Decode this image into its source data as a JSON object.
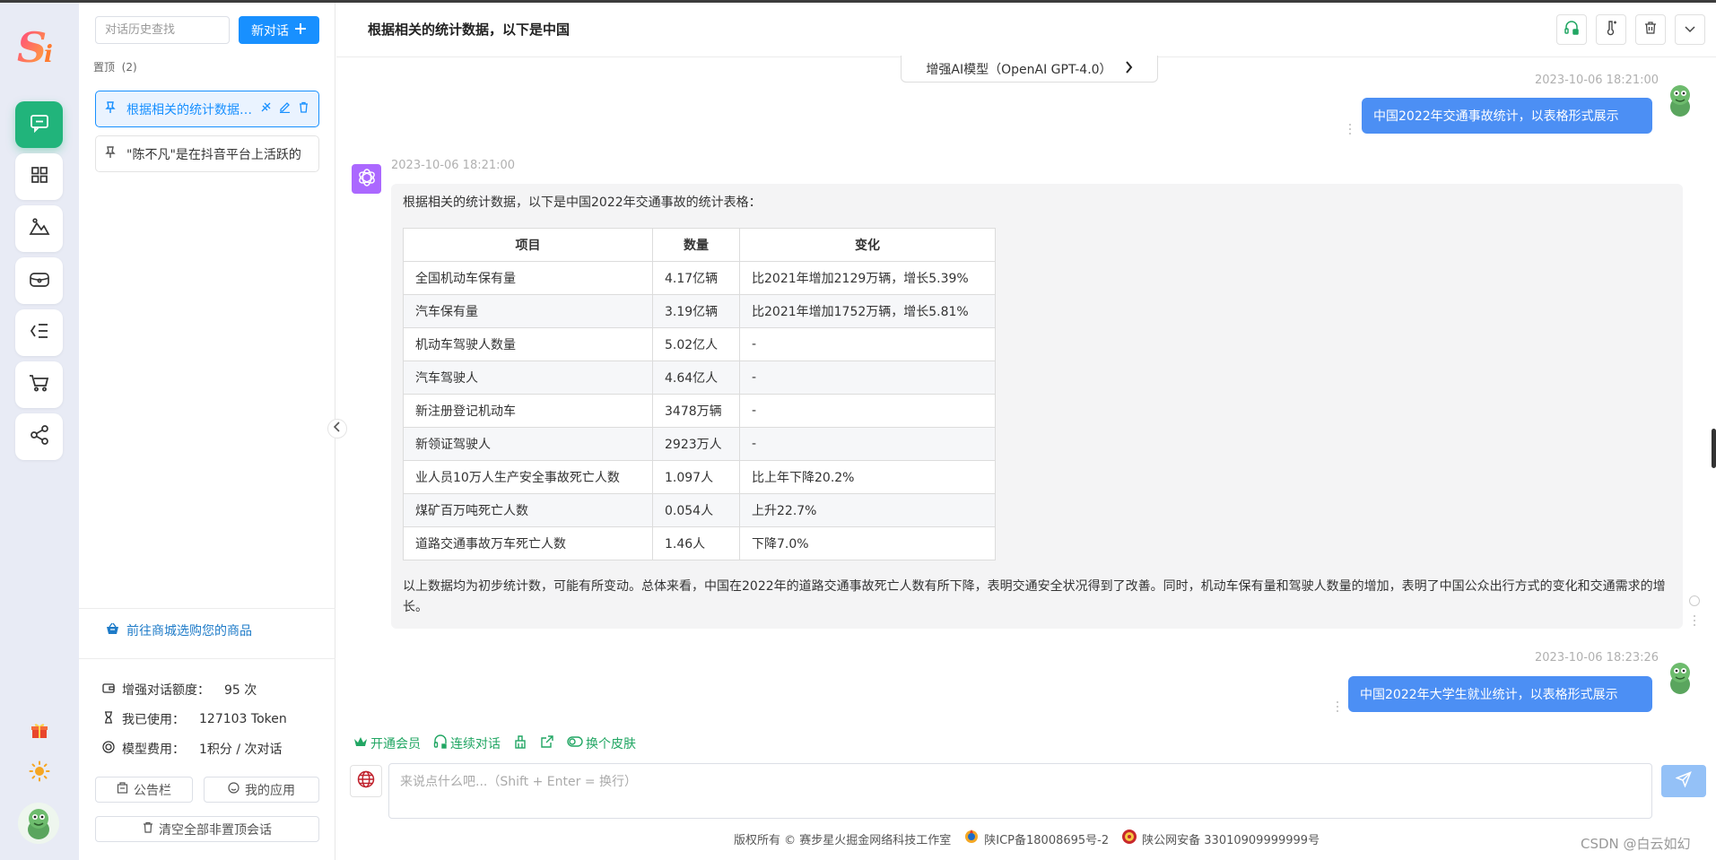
{
  "sidebar_rail": {
    "logo_text": "Si",
    "items": [
      {
        "name": "chat"
      },
      {
        "name": "apps"
      },
      {
        "name": "image"
      },
      {
        "name": "wallet"
      },
      {
        "name": "menu"
      },
      {
        "name": "cart"
      },
      {
        "name": "share"
      }
    ]
  },
  "history": {
    "search_placeholder": "对话历史查找",
    "new_chat_label": "新对话",
    "pinned_label": "置顶",
    "pinned_count": "(2)",
    "conversations": [
      {
        "title": "根据相关的统计数据，以下是中国"
      },
      {
        "title": "\"陈不凡\"是在抖音平台上活跃的"
      }
    ],
    "shop_link": "前往商城选购您的商品",
    "stats": {
      "quota_label": "增强对话额度：",
      "quota_value": "95 次",
      "used_label": "我已使用：",
      "used_value": "127103 Token",
      "fee_label": "模型费用：",
      "fee_value": "1积分 / 次对话"
    },
    "notice_button": "公告栏",
    "apps_button": "我的应用",
    "clear_button": "清空全部非置顶会话"
  },
  "header": {
    "title": "根据相关的统计数据，以下是中国"
  },
  "model_selector": {
    "label": "增强AI模型（OpenAI GPT-4.0）"
  },
  "messages": {
    "user1": {
      "time": "2023-10-06 18:21:00",
      "text": "中国2022年交通事故统计，以表格形式展示"
    },
    "assistant": {
      "time": "2023-10-06 18:21:00",
      "intro": "根据相关的统计数据，以下是中国2022年交通事故的统计表格：",
      "table": {
        "headers": [
          "项目",
          "数量",
          "变化"
        ],
        "rows": [
          [
            "全国机动车保有量",
            "4.17亿辆",
            "比2021年增加2129万辆，增长5.39%"
          ],
          [
            "汽车保有量",
            "3.19亿辆",
            "比2021年增加1752万辆，增长5.81%"
          ],
          [
            "机动车驾驶人数量",
            "5.02亿人",
            "-"
          ],
          [
            "汽车驾驶人",
            "4.64亿人",
            "-"
          ],
          [
            "新注册登记机动车",
            "3478万辆",
            "-"
          ],
          [
            "新领证驾驶人",
            "2923万人",
            "-"
          ],
          [
            "业人员10万人生产安全事故死亡人数",
            "1.097人",
            "比上年下降20.2%"
          ],
          [
            "煤矿百万吨死亡人数",
            "0.054人",
            "上升22.7%"
          ],
          [
            "道路交通事故万车死亡人数",
            "1.46人",
            "下降7.0%"
          ]
        ]
      },
      "summary": "以上数据均为初步统计数，可能有所变动。总体来看，中国在2022年的道路交通事故死亡人数有所下降，表明交通安全状况得到了改善。同时，机动车保有量和驾驶人数量的增加，表明了中国公众出行方式的变化和交通需求的增长。"
    },
    "user2": {
      "time": "2023-10-06 18:23:26",
      "text": "中国2022年大学生就业统计，以表格形式展示"
    }
  },
  "toolbar": {
    "vip_label": "开通会员",
    "continuous_label": "连续对话",
    "skin_label": "换个皮肤"
  },
  "input": {
    "placeholder": "来说点什么吧...（Shift + Enter = 换行）"
  },
  "footer": {
    "copyright": "版权所有 © 赛步星火掘金网络科技工作室",
    "icp": "陕ICP备18008695号-2",
    "police": "陕公网安备 33010909999999号"
  },
  "watermark": "CSDN @白云如幻",
  "colors": {
    "accent_green": "#21b47b",
    "primary_blue": "#1890ff",
    "bubble_blue": "#4c8ff4"
  }
}
